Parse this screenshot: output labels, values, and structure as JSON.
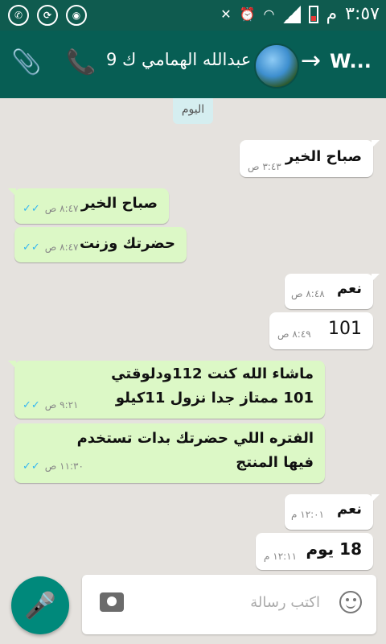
{
  "status_bar": {
    "time": "٣:٥٧",
    "ampm": "م"
  },
  "header": {
    "contact_name": "عبدالله الهمامي ك 9",
    "back_label": "W..."
  },
  "chat": {
    "date_label": "اليوم",
    "messages": [
      {
        "direction": "incoming",
        "text": "صباح الخير",
        "time": "٣:٤٣ ص"
      },
      {
        "direction": "outgoing",
        "text": "صباح الخير",
        "time": "٨:٤٧ ص",
        "status": "read"
      },
      {
        "direction": "outgoing",
        "text": "حضرتك وزنت",
        "time": "٨:٤٧ ص",
        "status": "read"
      },
      {
        "direction": "incoming",
        "text": "نعم",
        "time": "٨:٤٨ ص"
      },
      {
        "direction": "incoming",
        "text": "101",
        "time": "٨:٤٩ ص"
      },
      {
        "direction": "outgoing",
        "line1": "ماشاء الله كنت 112ودلوقتي",
        "line2": "101 ممتاز جدا نزول 11كيلو",
        "time": "٩:٢١ ص",
        "status": "read"
      },
      {
        "direction": "outgoing",
        "line1": "الفتره اللي حضرتك بدات تستخدم",
        "line2": "فيها المنتج",
        "time": "١١:٣٠ ص",
        "status": "read"
      },
      {
        "direction": "incoming",
        "text": "نعم",
        "time": "١٢:٠١ م"
      },
      {
        "direction": "incoming",
        "text": "18 يوم",
        "time": "١٢:١١ م"
      }
    ]
  },
  "composer": {
    "placeholder": "اكتب رسالة"
  },
  "colors": {
    "app_bar": "#075e54",
    "status_bar": "#0f5b4f",
    "outgoing_bubble": "#dcf8c6",
    "incoming_bubble": "#ffffff",
    "chat_background": "#e5e2de",
    "read_ticks": "#34b7f1",
    "mic_button": "#00897b"
  },
  "icons": [
    "whatsapp-icon",
    "sync-icon",
    "camera-status-icon",
    "mute-icon",
    "alarm-icon",
    "wifi-icon",
    "signal-icon",
    "battery-icon",
    "attach-icon",
    "call-icon",
    "avatar",
    "back-arrow-icon",
    "mic-icon",
    "camera-icon",
    "emoji-icon"
  ]
}
